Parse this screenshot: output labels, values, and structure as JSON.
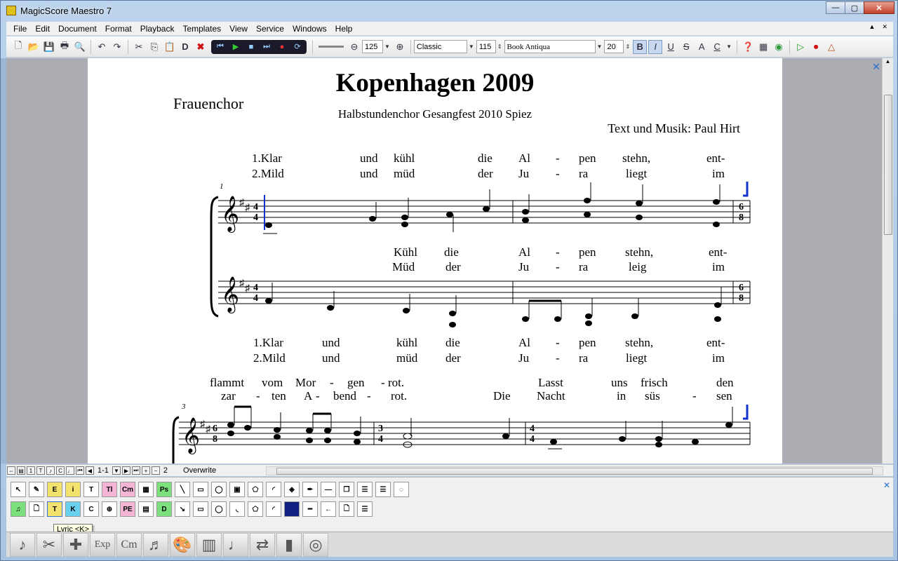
{
  "window": {
    "title": "MagicScore Maestro 7",
    "minimize": "—",
    "maximize": "▢",
    "close": "✕"
  },
  "menu": [
    "File",
    "Edit",
    "Document",
    "Format",
    "Playback",
    "Templates",
    "View",
    "Service",
    "Windows",
    "Help"
  ],
  "toolbar": {
    "zoom": "125",
    "style": "Classic",
    "size_percent": "115",
    "font": "Book Antiqua",
    "font_size": "20",
    "bold": "B",
    "italic": "I",
    "underline": "U",
    "strike": "S",
    "caps": "A",
    "color": "C",
    "delete_label": "D"
  },
  "score": {
    "title": "Kopenhagen 2009",
    "subtitle": "Halbstundenchor Gesangfest 2010 Spiez",
    "composer": "Text und Musik: Paul Hirt",
    "instrument": "Frauenchor",
    "measure1": "1",
    "measure3": "3",
    "lyrics": {
      "top_v1": [
        "1.Klar",
        "und",
        "kühl",
        "die",
        "Al",
        "-",
        "pen",
        "stehn,",
        "ent-"
      ],
      "top_v2": [
        "2.Mild",
        "und",
        "müd",
        "der",
        "Ju",
        "-",
        "ra",
        "liegt",
        "im"
      ],
      "mid_v1": [
        "Kühl",
        "die",
        "Al",
        "-",
        "pen",
        "stehn,",
        "ent-"
      ],
      "mid_v2": [
        "Müd",
        "der",
        "Ju",
        "-",
        "ra",
        "leig",
        "im"
      ],
      "bot_v1": [
        "1.Klar",
        "und",
        "kühl",
        "die",
        "Al",
        "-",
        "pen",
        "stehn,",
        "ent-"
      ],
      "bot_v2": [
        "2.Mild",
        "und",
        "müd",
        "der",
        "Ju",
        "-",
        "ra",
        "liegt",
        "im"
      ],
      "sys2_v1": [
        "flammt",
        "vom",
        "Mor",
        "-",
        "gen",
        "-",
        "rot.",
        "Lasst",
        "uns",
        "frisch",
        "den"
      ],
      "sys2_v2": [
        "zar",
        "-",
        "ten",
        "A",
        "-",
        "bend",
        "-",
        "rot.",
        "Die",
        "Nacht",
        "in",
        "süs",
        "-",
        "sen"
      ]
    }
  },
  "status": {
    "page": "1-1",
    "count": "2",
    "mode": "Overwrite"
  },
  "tooltip": "Lyric <K>",
  "palette_row1": [
    "E",
    "i",
    "T",
    "Tl",
    "Cm",
    "Ps"
  ],
  "palette_row2": [
    "T",
    "C",
    "PE",
    "D"
  ],
  "bottom_tools": [
    "Exp",
    "Cm"
  ]
}
